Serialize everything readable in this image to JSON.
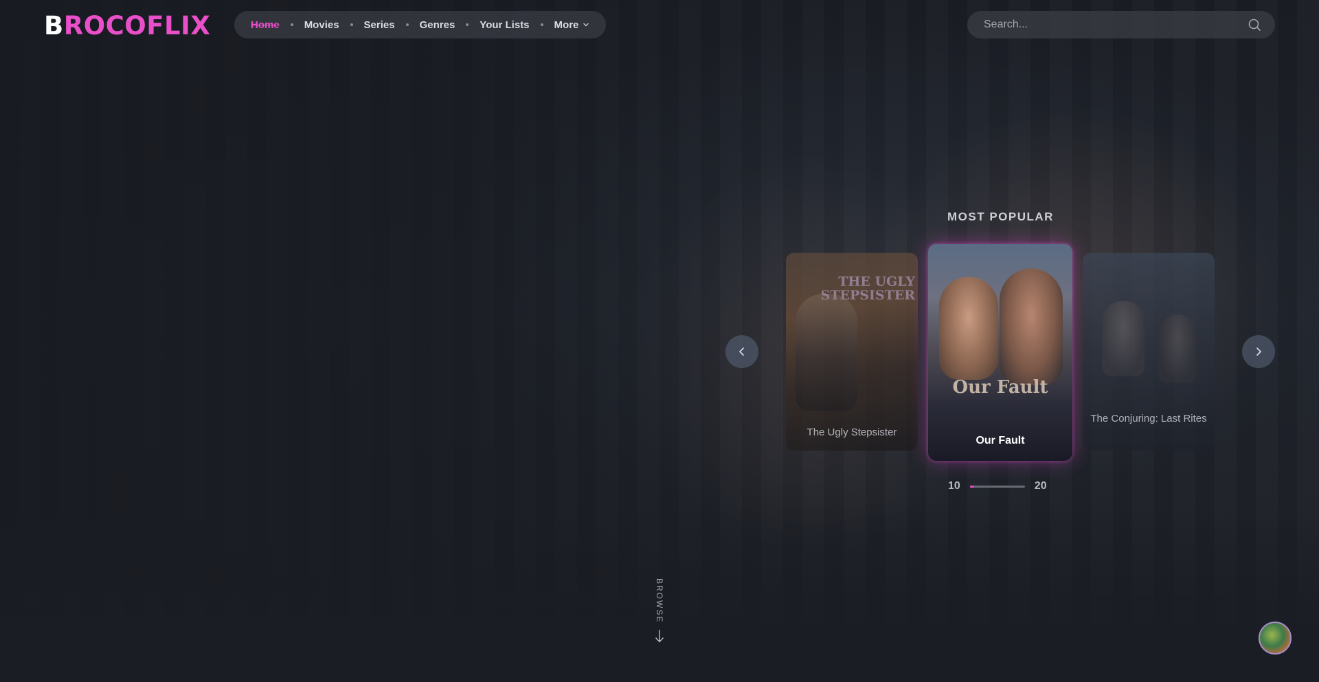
{
  "brand": {
    "first_letter": "B",
    "rest": "ROCOFLIX",
    "accent": "#e94fc8"
  },
  "nav": {
    "items": [
      {
        "label": "Home",
        "active": true
      },
      {
        "label": "Movies"
      },
      {
        "label": "Series"
      },
      {
        "label": "Genres"
      },
      {
        "label": "Your Lists"
      },
      {
        "label": "More",
        "icon": "chevron-down-icon"
      }
    ]
  },
  "search": {
    "placeholder": "Search...",
    "icon": "search-icon"
  },
  "most_popular": {
    "title": "MOST POPULAR",
    "cards": [
      {
        "caption": "The Ugly Stepsister",
        "poster_title": "THE UGLY STEPSISTER"
      },
      {
        "caption": "Our Fault",
        "poster_title": "Our Fault",
        "featured": true
      },
      {
        "caption": "The Conjuring: Last Rites"
      }
    ],
    "prev_icon": "chevron-left-icon",
    "next_icon": "chevron-right-icon",
    "pager": {
      "current": "10",
      "total": "20",
      "progress": 0.08
    }
  },
  "browse": {
    "label": "BROWSE",
    "icon": "arrow-down-icon"
  },
  "avatar": {
    "icon": "avatar"
  }
}
